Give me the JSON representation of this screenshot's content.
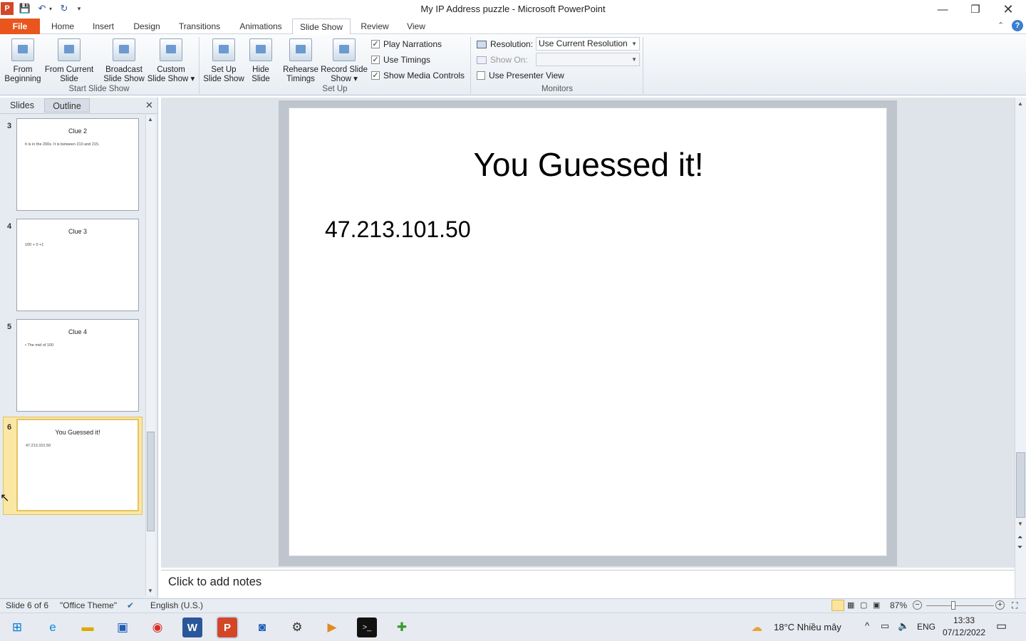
{
  "window": {
    "title": "My IP Address puzzle  -  Microsoft PowerPoint"
  },
  "tabs": [
    "File",
    "Home",
    "Insert",
    "Design",
    "Transitions",
    "Animations",
    "Slide Show",
    "Review",
    "View"
  ],
  "ribbon": {
    "start_group": "Start Slide Show",
    "from_beginning": "From Beginning",
    "from_current": "From Current Slide",
    "broadcast": "Broadcast Slide Show",
    "custom": "Custom Slide Show ▾",
    "setup_group": "Set Up",
    "setup_show": "Set Up Slide Show",
    "hide_slide": "Hide Slide",
    "rehearse": "Rehearse Timings",
    "record": "Record Slide Show ▾",
    "play_narrations": "Play Narrations",
    "use_timings": "Use Timings",
    "show_media": "Show Media Controls",
    "monitors_group": "Monitors",
    "resolution_label": "Resolution:",
    "resolution_value": "Use Current Resolution",
    "show_on_label": "Show On:",
    "presenter_view": "Use Presenter View"
  },
  "pane": {
    "tab_slides": "Slides",
    "tab_outline": "Outline"
  },
  "thumbnails": [
    {
      "num": "3",
      "title": "Clue 2",
      "body": "It is in the 200s. It is between 210 and 215."
    },
    {
      "num": "4",
      "title": "Clue 3",
      "body": "100 + 0 +1"
    },
    {
      "num": "5",
      "title": "Clue 4",
      "body": "•  The mid of 100"
    },
    {
      "num": "6",
      "title": "You Guessed it!",
      "body": "47.213.101.50"
    }
  ],
  "slide": {
    "title": "You Guessed it!",
    "body": "47.213.101.50"
  },
  "notes": "Click to add notes",
  "status": {
    "slide": "Slide 6 of 6",
    "theme": "\"Office Theme\"",
    "language": "English (U.S.)",
    "zoom": "87%"
  },
  "taskbar": {
    "weather": "18°C  Nhiều mây",
    "lang": "ENG",
    "time": "13:33",
    "date": "07/12/2022"
  }
}
